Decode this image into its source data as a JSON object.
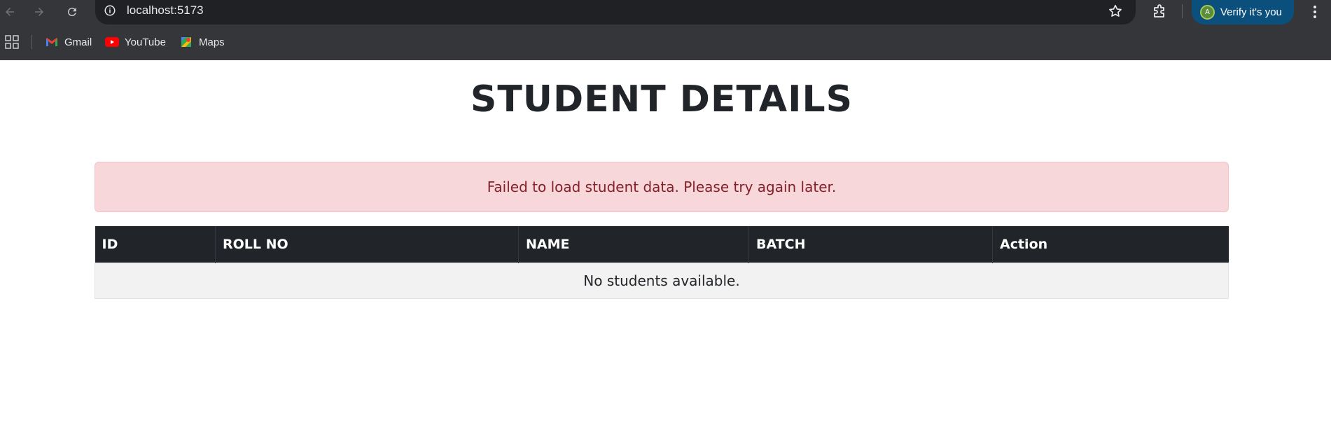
{
  "browser": {
    "url": "localhost:5173",
    "verify_label": "Verify it's you",
    "avatar_letter": "A",
    "bookmarks": [
      {
        "label": "Gmail",
        "icon": "gmail-icon"
      },
      {
        "label": "YouTube",
        "icon": "youtube-icon"
      },
      {
        "label": "Maps",
        "icon": "maps-icon"
      }
    ]
  },
  "page": {
    "title": "STUDENT DETAILS",
    "alert_message": "Failed to load student data. Please try again later.",
    "table": {
      "headers": [
        "ID",
        "ROLL NO",
        "NAME",
        "BATCH",
        "Action"
      ],
      "empty_message": "No students available."
    }
  },
  "colors": {
    "alert_bg": "#f8d7da",
    "alert_text": "#842029",
    "table_header_bg": "#212529",
    "browser_chrome": "#35363a",
    "verify_button_bg": "#0b4f7c"
  }
}
